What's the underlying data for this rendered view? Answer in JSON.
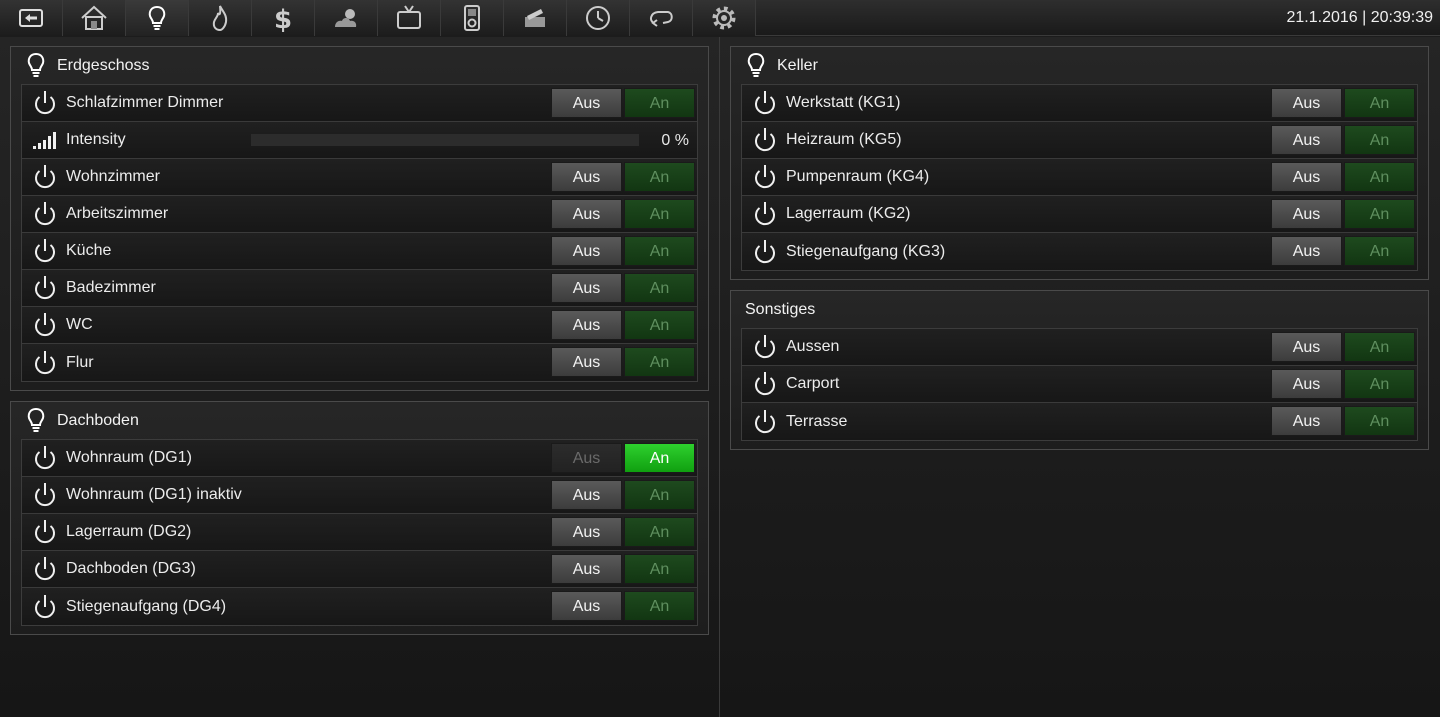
{
  "toolbar": {
    "datetime": "21.1.2016 | 20:39:39",
    "icons": [
      "back-icon",
      "home-icon",
      "lightbulb-icon",
      "flame-icon",
      "dollar-icon",
      "weather-icon",
      "tv-icon",
      "media-player-icon",
      "mail-icon",
      "clock-icon",
      "loop-icon",
      "gear-icon"
    ]
  },
  "erdgeschoss": {
    "title": "Erdgeschoss",
    "rows": [
      {
        "label": "Schlafzimmer Dimmer",
        "aus": "Aus",
        "an": "An"
      },
      {
        "label": "Intensity",
        "value": "0 %",
        "level": 0
      },
      {
        "label": "Wohnzimmer",
        "aus": "Aus",
        "an": "An"
      },
      {
        "label": "Arbeitszimmer",
        "aus": "Aus",
        "an": "An"
      },
      {
        "label": "Küche",
        "aus": "Aus",
        "an": "An"
      },
      {
        "label": "Badezimmer",
        "aus": "Aus",
        "an": "An"
      },
      {
        "label": "WC",
        "aus": "Aus",
        "an": "An"
      },
      {
        "label": "Flur",
        "aus": "Aus",
        "an": "An"
      }
    ]
  },
  "dachboden": {
    "title": "Dachboden",
    "rows": [
      {
        "label": "Wohnraum (DG1)",
        "aus": "Aus",
        "an": "An",
        "state": "on"
      },
      {
        "label": "Wohnraum (DG1) inaktiv",
        "aus": "Aus",
        "an": "An"
      },
      {
        "label": "Lagerraum (DG2)",
        "aus": "Aus",
        "an": "An"
      },
      {
        "label": "Dachboden (DG3)",
        "aus": "Aus",
        "an": "An"
      },
      {
        "label": "Stiegenaufgang (DG4)",
        "aus": "Aus",
        "an": "An"
      }
    ]
  },
  "keller": {
    "title": "Keller",
    "rows": [
      {
        "label": "Werkstatt (KG1)",
        "aus": "Aus",
        "an": "An"
      },
      {
        "label": "Heizraum (KG5)",
        "aus": "Aus",
        "an": "An"
      },
      {
        "label": "Pumpenraum (KG4)",
        "aus": "Aus",
        "an": "An"
      },
      {
        "label": "Lagerraum (KG2)",
        "aus": "Aus",
        "an": "An"
      },
      {
        "label": "Stiegenaufgang (KG3)",
        "aus": "Aus",
        "an": "An"
      }
    ]
  },
  "sonstiges": {
    "title": "Sonstiges",
    "rows": [
      {
        "label": "Aussen",
        "aus": "Aus",
        "an": "An"
      },
      {
        "label": "Carport",
        "aus": "Aus",
        "an": "An"
      },
      {
        "label": "Terrasse",
        "aus": "Aus",
        "an": "An"
      }
    ]
  },
  "colors": {
    "accent_on": "#22c022",
    "an_off": "#1a421a",
    "aus": "#4a4a4a"
  }
}
